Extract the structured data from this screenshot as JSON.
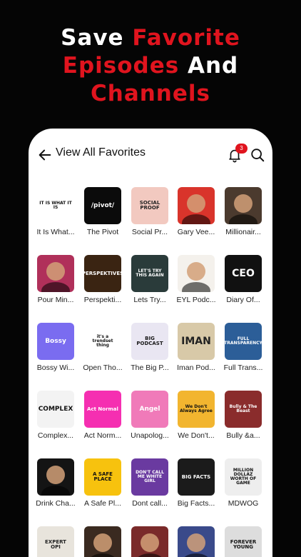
{
  "headline": {
    "line1_white": "Save ",
    "line1_red": "Favorite",
    "line2_red": "Episodes",
    "line2_white": " And",
    "line3_red": "Channels"
  },
  "header": {
    "title": "View All Favorites",
    "notification_count": "3"
  },
  "items": [
    {
      "label": "It Is What...",
      "art_text": "IT IS WHAT IT IS",
      "bg": "#ffffff",
      "fg": "#111111"
    },
    {
      "label": "The Pivot",
      "art_text": "/pivot/",
      "bg": "#0b0b0b",
      "fg": "#ffffff"
    },
    {
      "label": "Social Pr...",
      "art_text": "SOCIAL PROOF",
      "bg": "#f2c9c0",
      "fg": "#222222"
    },
    {
      "label": "Gary Vee...",
      "art_text": "",
      "bg": "#d9342b",
      "fg": "#ffffff"
    },
    {
      "label": "Millionair...",
      "art_text": "",
      "bg": "#4b3a2e",
      "fg": "#ffffff"
    },
    {
      "label": "Pour Min...",
      "art_text": "",
      "bg": "#b0305a",
      "fg": "#ffffff"
    },
    {
      "label": "Perspekti...",
      "art_text": "PERSPEKTIVES",
      "bg": "#3a2412",
      "fg": "#ffffff"
    },
    {
      "label": "Lets Try...",
      "art_text": "LET'S TRY THIS AGAIN",
      "bg": "#2a3b3a",
      "fg": "#ffffff"
    },
    {
      "label": "EYL Podc...",
      "art_text": "",
      "bg": "#f4f1ec",
      "fg": "#222222"
    },
    {
      "label": "Diary Of...",
      "art_text": "CEO",
      "bg": "#111111",
      "fg": "#ffffff"
    },
    {
      "label": "Bossy Wi...",
      "art_text": "Bossy",
      "bg": "#7a6cf0",
      "fg": "#ffffff"
    },
    {
      "label": "Open Tho...",
      "art_text": "it's a trendset thing",
      "bg": "#ffffff",
      "fg": "#111111"
    },
    {
      "label": "The Big P...",
      "art_text": "BIG PODCAST",
      "bg": "#e9e6f2",
      "fg": "#1a1a1a"
    },
    {
      "label": "Iman Pod...",
      "art_text": "IMAN",
      "bg": "#d8c9a8",
      "fg": "#222222"
    },
    {
      "label": "Full Trans...",
      "art_text": "FULL TRANSPARENCY",
      "bg": "#2c5e98",
      "fg": "#ffffff"
    },
    {
      "label": "Complex...",
      "art_text": "COMPLEX",
      "bg": "#f3f3f3",
      "fg": "#111111"
    },
    {
      "label": "Act Norm...",
      "art_text": "Act Normal",
      "bg": "#f52fb1",
      "fg": "#ffffff"
    },
    {
      "label": "Unapolog...",
      "art_text": "Angel",
      "bg": "#f07ab9",
      "fg": "#ffffff"
    },
    {
      "label": "We Don't...",
      "art_text": "We Don't Always Agree",
      "bg": "#f2b52f",
      "fg": "#111111"
    },
    {
      "label": "Bully &a...",
      "art_text": "Bully & The Beast",
      "bg": "#8a2c2c",
      "fg": "#ffffff"
    },
    {
      "label": "Drink Cha...",
      "art_text": "",
      "bg": "#141414",
      "fg": "#ffffff"
    },
    {
      "label": "A Safe Pl...",
      "art_text": "A SAFE PLACE",
      "bg": "#f7c20e",
      "fg": "#111111"
    },
    {
      "label": "Dont call...",
      "art_text": "DON'T CALL ME WHITE GIRL",
      "bg": "#6a3aa0",
      "fg": "#ffffff"
    },
    {
      "label": "Big Facts...",
      "art_text": "BIG FACTS",
      "bg": "#1b1b1b",
      "fg": "#ffffff"
    },
    {
      "label": "MDWOG",
      "art_text": "MILLION DOLLAZ WORTH OF GAME",
      "bg": "#eeeeee",
      "fg": "#111111"
    },
    {
      "label": "",
      "art_text": "EXPERT OPI",
      "bg": "#e8e4dc",
      "fg": "#222222"
    },
    {
      "label": "",
      "art_text": "",
      "bg": "#3a2a20",
      "fg": "#ffffff"
    },
    {
      "label": "",
      "art_text": "",
      "bg": "#7a2a2a",
      "fg": "#ffffff"
    },
    {
      "label": "",
      "art_text": "",
      "bg": "#3a4a8a",
      "fg": "#ffffff"
    },
    {
      "label": "",
      "art_text": "FOREVER YOUNG",
      "bg": "#dddddd",
      "fg": "#111111"
    }
  ]
}
